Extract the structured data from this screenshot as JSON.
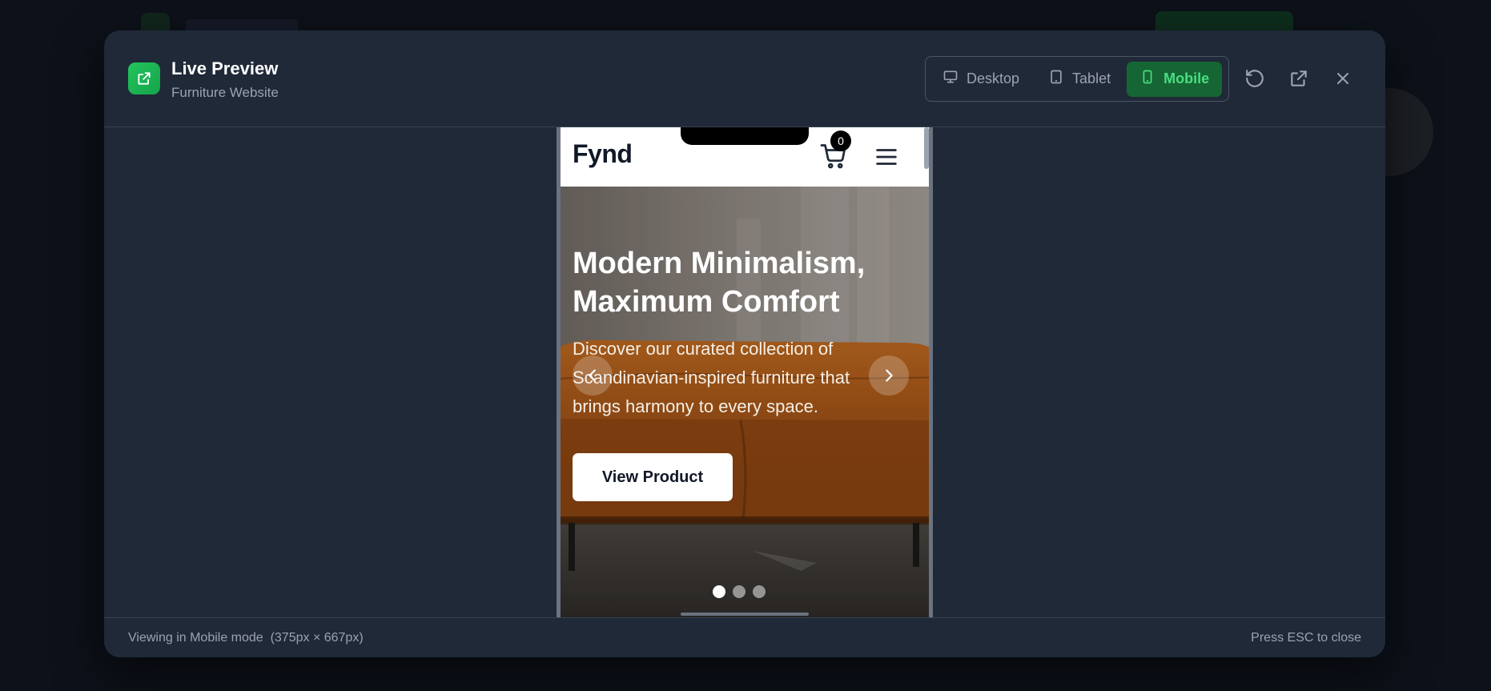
{
  "modal": {
    "title": "Live Preview",
    "subtitle": "Furniture Website"
  },
  "view_modes": [
    {
      "label": "Desktop",
      "icon": "monitor-icon",
      "active": false
    },
    {
      "label": "Tablet",
      "icon": "tablet-icon",
      "active": false
    },
    {
      "label": "Mobile",
      "icon": "smartphone-icon",
      "active": true
    }
  ],
  "header_actions": [
    "refresh-icon",
    "external-link-icon",
    "close-icon"
  ],
  "site": {
    "brand": "Fynd",
    "cart_count": "0",
    "hero": {
      "heading": "Modern Minimalism, Maximum Comfort",
      "description": "Discover our curated collection of Scandinavian-inspired furniture that brings harmony to every space.",
      "cta": "View Product",
      "slides": 3,
      "active_slide": 1
    }
  },
  "footer": {
    "mode_text": "Viewing in Mobile mode",
    "size_text": "(375px × 667px)",
    "esc_hint": "Press ESC to close"
  },
  "colors": {
    "accent": "#22c55e",
    "active_bg": "#166534",
    "active_text": "#4ade80",
    "modal_bg": "#1f2937"
  }
}
